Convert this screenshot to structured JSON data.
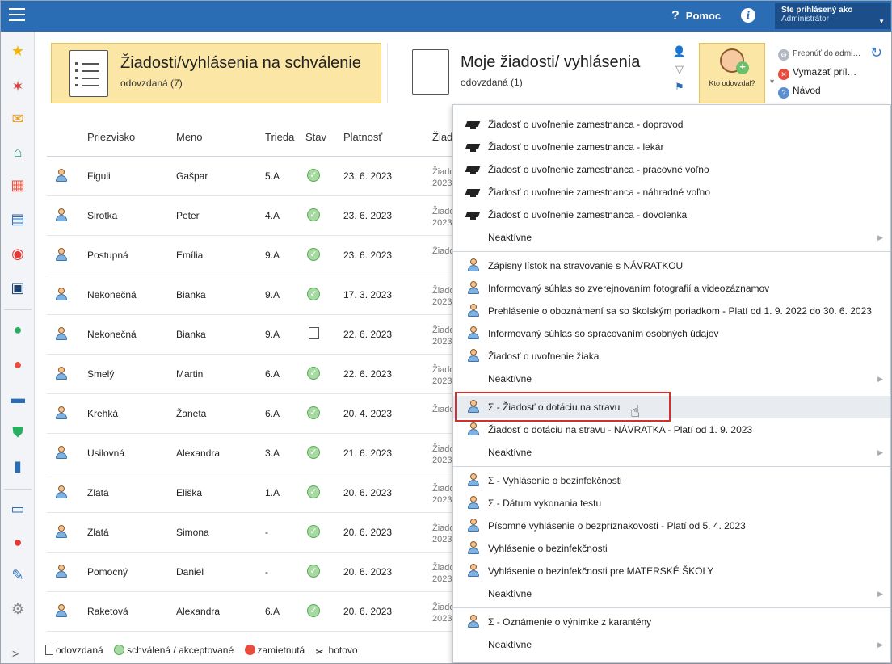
{
  "topbar": {
    "help_label": "Pomoc",
    "help_glyph": "?",
    "info_glyph": "i",
    "user_line1": "Ste prihlásený ako",
    "user_line2": "Administrátor"
  },
  "tiles": {
    "approve_title": "Žiadosti/vyhlásenia na schválenie",
    "approve_sub": "odovzdaná (7)",
    "mine_title": "Moje žiadosti/ vyhlásenia",
    "mine_sub": "odovzdaná (1)"
  },
  "who_button": {
    "label": "Kto odovzdal?"
  },
  "actions": {
    "switch_admin": "Prepnúť do admi…",
    "delete_attach": "Vymazať príl…",
    "guide": "Návod"
  },
  "table": {
    "headers": [
      "Priezvisko",
      "Meno",
      "Trieda",
      "Stav",
      "Platnosť",
      "Žiad"
    ],
    "rows": [
      {
        "surname": "Figuli",
        "name": "Gašpar",
        "class": "5.A",
        "status": "ok",
        "validity": "23. 6. 2023",
        "cut1": "Žiado",
        "cut2": "2023"
      },
      {
        "surname": "Sirotka",
        "name": "Peter",
        "class": "4.A",
        "status": "ok",
        "validity": "23. 6. 2023",
        "cut1": "Žiado",
        "cut2": "2023"
      },
      {
        "surname": "Postupná",
        "name": "Emília",
        "class": "9.A",
        "status": "ok",
        "validity": "23. 6. 2023",
        "cut1": "Žiado",
        "cut2": ""
      },
      {
        "surname": "Nekonečná",
        "name": "Bianka",
        "class": "9.A",
        "status": "ok",
        "validity": "17. 3. 2023",
        "cut1": "Žiado",
        "cut2": "2023"
      },
      {
        "surname": "Nekonečná",
        "name": "Bianka",
        "class": "9.A",
        "status": "doc",
        "validity": "22. 6. 2023",
        "cut1": "Žiado",
        "cut2": "2023"
      },
      {
        "surname": "Smelý",
        "name": "Martin",
        "class": "6.A",
        "status": "ok",
        "validity": "22. 6. 2023",
        "cut1": "Žiado",
        "cut2": "2023"
      },
      {
        "surname": "Krehká",
        "name": "Žaneta",
        "class": "6.A",
        "status": "ok",
        "validity": "20. 4. 2023",
        "cut1": "Žiado",
        "cut2": ""
      },
      {
        "surname": "Usilovná",
        "name": "Alexandra",
        "class": "3.A",
        "status": "ok",
        "validity": "21. 6. 2023",
        "cut1": "Žiado",
        "cut2": "2023"
      },
      {
        "surname": "Zlatá",
        "name": "Eliška",
        "class": "1.A",
        "status": "ok",
        "validity": "20. 6. 2023",
        "cut1": "Žiado",
        "cut2": "2023"
      },
      {
        "surname": "Zlatá",
        "name": "Simona",
        "class": "-",
        "status": "ok",
        "validity": "20. 6. 2023",
        "cut1": "Žiado",
        "cut2": "2023"
      },
      {
        "surname": "Pomocný",
        "name": "Daniel",
        "class": "-",
        "status": "ok",
        "validity": "20. 6. 2023",
        "cut1": "Žiado",
        "cut2": "2023"
      },
      {
        "surname": "Raketová",
        "name": "Alexandra",
        "class": "6.A",
        "status": "ok",
        "validity": "20. 6. 2023",
        "cut1": "Žiado",
        "cut2": "2023"
      }
    ]
  },
  "legend": {
    "submitted": "odovzdaná",
    "approved": "schválená / akceptované",
    "rejected": "zamietnutá",
    "done": "hotovo"
  },
  "menu": {
    "groups": [
      {
        "icon": "graduation-cap",
        "items": [
          "Žiadosť o uvoľnenie zamestnanca - doprovod",
          "Žiadosť o uvoľnenie zamestnanca - lekár",
          "Žiadosť o uvoľnenie zamestnanca - pracovné voľno",
          "Žiadosť o uvoľnenie zamestnanca - náhradné voľno",
          "Žiadosť o uvoľnenie zamestnanca - dovolenka"
        ],
        "inactive": "Neaktívne"
      },
      {
        "icon": "student",
        "items": [
          "Zápisný lístok na stravovanie s NÁVRATKOU",
          "Informovaný súhlas so zverejnovaním fotografií a videozáznamov",
          "Prehlásenie o oboznámení sa so školským poriadkom - Platí od 1. 9. 2022 do 30. 6. 2023",
          "Informovaný súhlas so spracovaním osobných údajov",
          "Žiadosť o uvoľnenie žiaka"
        ],
        "inactive": "Neaktívne"
      },
      {
        "icon": "student",
        "items": [
          "Σ - Žiadosť o dotáciu na stravu",
          "Žiadosť o dotáciu na stravu - NÁVRATKA - Platí od 1. 9. 2023"
        ],
        "inactive": "Neaktívne"
      },
      {
        "icon": "student",
        "items": [
          "Σ - Vyhlásenie o bezinfekčnosti",
          "Σ - Dátum vykonania testu",
          "Písomné vyhlásenie o bezpríznakovosti - Platí od 5. 4. 2023",
          "Vyhlásenie o bezinfekčnosti",
          "Vyhlásenie o bezinfekčnosti pre MATERSKÉ ŠKOLY"
        ],
        "inactive": "Neaktívne"
      },
      {
        "icon": "student",
        "items": [
          "Σ - Oznámenie o výnimke z karantény"
        ],
        "inactive": "Neaktívne"
      }
    ]
  },
  "colors": {
    "topbar": "#2a6db5",
    "tile_active": "#fbe6a6",
    "highlight_border": "#d32f2f"
  }
}
